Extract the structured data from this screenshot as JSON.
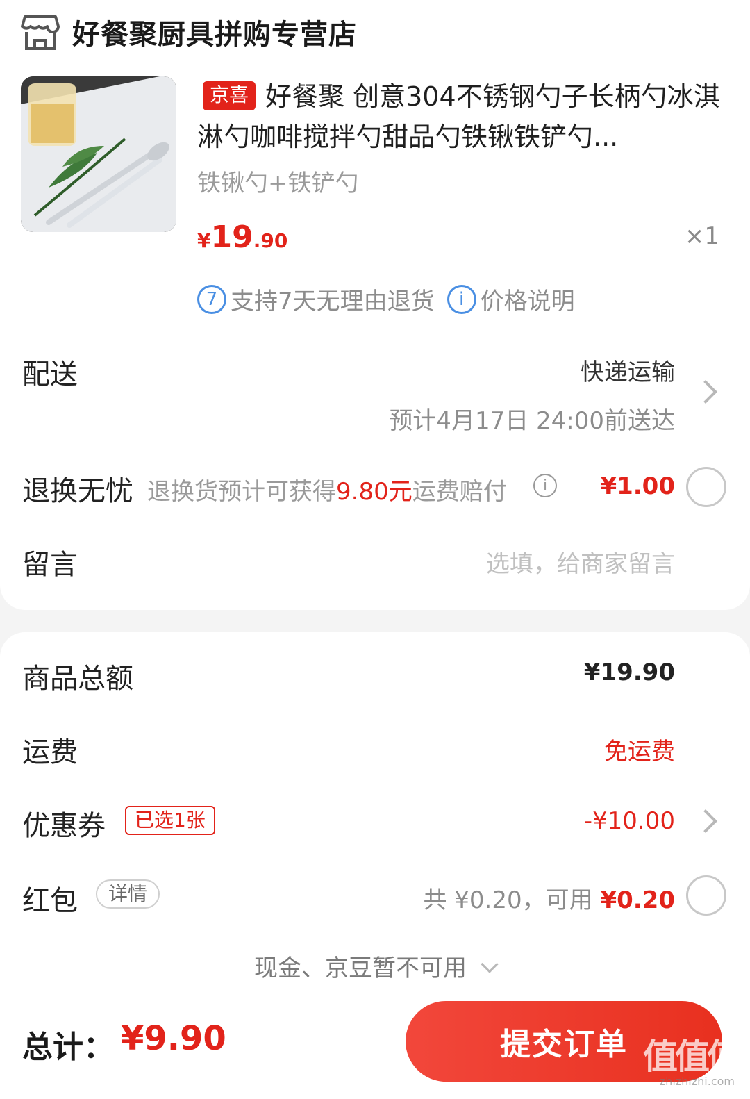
{
  "store": {
    "name": "好餐聚厨具拼购专营店",
    "icon": "store-icon"
  },
  "product": {
    "badge": "京喜",
    "title": "好餐聚 创意304不锈钢勺子长柄勺冰淇淋勺咖啡搅拌勺甜品勺铁锹铁铲勺...",
    "sku": "铁锹勺+铁铲勺",
    "price_symbol": "¥",
    "price_int": "19",
    "price_dec": ".90",
    "qty": "×1"
  },
  "services": {
    "return_icon_text": "7",
    "return_text": "支持7天无理由退货",
    "price_icon_text": "i",
    "price_text": "价格说明"
  },
  "delivery": {
    "label": "配送",
    "method": "快递运输",
    "eta": "预计4月17日 24:00前送达"
  },
  "return_insurance": {
    "label": "退换无忧",
    "desc_prefix": "退换货预计可获得",
    "desc_highlight": "9.80元",
    "desc_suffix": "运费赔付",
    "info_icon": "i",
    "price": "¥1.00"
  },
  "message": {
    "label": "留言",
    "placeholder": "选填，给商家留言"
  },
  "summary": {
    "goods_label": "商品总额",
    "goods_value": "¥19.90",
    "shipping_label": "运费",
    "shipping_value": "免运费",
    "coupon_label": "优惠券",
    "coupon_tag": "已选1张",
    "coupon_value": "-¥10.00",
    "redpacket_label": "红包",
    "redpacket_tag": "详情",
    "redpacket_total": "共 ¥0.20，可用",
    "redpacket_available": "¥0.20",
    "cash_note": "现金、京豆暂不可用"
  },
  "footer": {
    "total_label": "总计：",
    "total_value": "¥9.90",
    "submit_label": "提交订单",
    "watermark": "值值值",
    "watermark_sub": "zhizhizhi.com"
  },
  "colors": {
    "accent_red": "#e2231a",
    "info_blue": "#4a8fe3"
  }
}
